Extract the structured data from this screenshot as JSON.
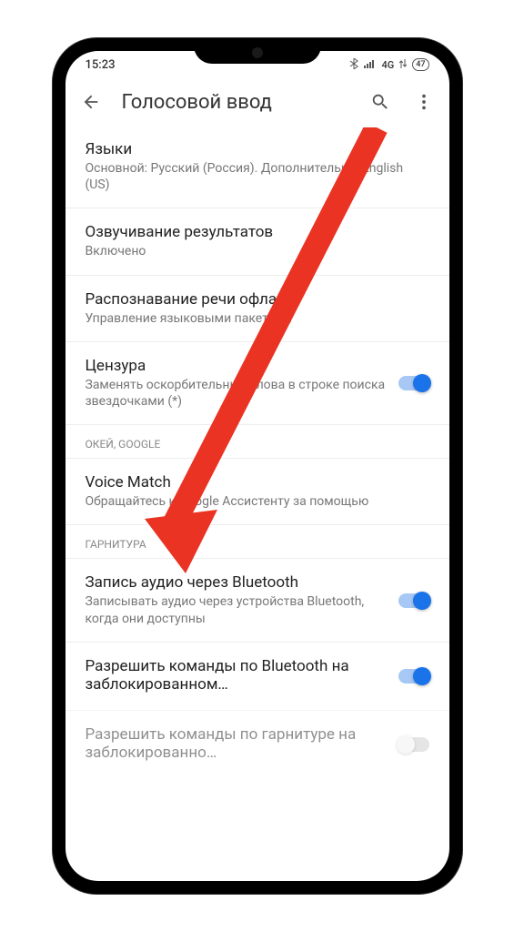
{
  "status": {
    "time": "15:23",
    "network": "4G",
    "battery": "47"
  },
  "appbar": {
    "title": "Голосовой ввод"
  },
  "items": [
    {
      "title": "Языки",
      "sub": "Основной: Русский (Россия). Дополнительно: English (US)"
    },
    {
      "title": "Озвучивание результатов",
      "sub": "Включено"
    },
    {
      "title": "Распознавание речи офлайн",
      "sub": "Управление языковыми пакетами"
    },
    {
      "title": "Цензура",
      "sub": "Заменять оскорбительные слова в строке поиска звездочками (*)"
    }
  ],
  "section1": {
    "header": "ОКЕЙ, GOOGLE",
    "item": {
      "title": "Voice Match",
      "sub": "Обращайтесь к Google Ассистенту за помощью"
    }
  },
  "section2": {
    "header": "ГАРНИТУРА",
    "items": [
      {
        "title": "Запись аудио через Bluetooth",
        "sub": "Записывать аудио через устройства Bluetooth, когда они доступны"
      },
      {
        "title": "Разрешить команды по Bluetooth на заблокированном…",
        "sub": ""
      },
      {
        "title": "Разрешить команды по гарнитуре на заблокированно…",
        "sub": ""
      }
    ]
  }
}
